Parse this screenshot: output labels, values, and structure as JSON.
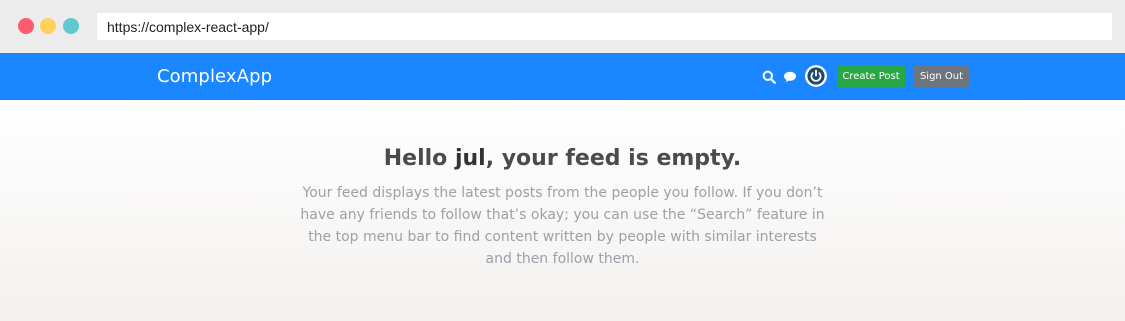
{
  "browser": {
    "url": "https://complex-react-app/",
    "window_controls": [
      "close",
      "minimize",
      "maximize"
    ]
  },
  "navbar": {
    "brand": "ComplexApp",
    "icons": [
      "search-icon",
      "chat-icon",
      "avatar-power-icon"
    ],
    "create_post_label": "Create Post",
    "sign_out_label": "Sign Out"
  },
  "colors": {
    "navbar": "#1a86ff",
    "create_button": "#28a745",
    "signout_button": "#6c757d"
  },
  "feed": {
    "greeting_prefix": "Hello ",
    "username": "jul",
    "greeting_suffix": ", your feed is empty.",
    "description": "Your feed displays the latest posts from the people you follow. If you don’t have any friends to follow that’s okay; you can use the “Search” feature in the top menu bar to find content written by people with similar interests and then follow them."
  }
}
